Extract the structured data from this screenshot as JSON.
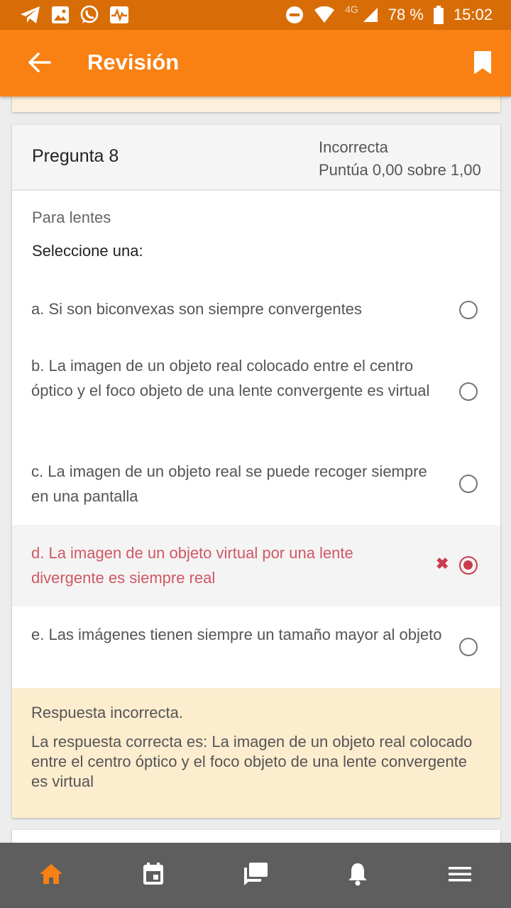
{
  "status_bar": {
    "battery": "78 %",
    "time": "15:02",
    "network": "4G"
  },
  "app_bar": {
    "title": "Revisión"
  },
  "question": {
    "title": "Pregunta 8",
    "state": "Incorrecta",
    "grade": "Puntúa 0,00 sobre 1,00",
    "text": "Para lentes",
    "prompt": "Seleccione una:",
    "options": [
      {
        "label": "a. Si son biconvexas son siempre convergentes",
        "selected": false
      },
      {
        "label": "b. La imagen de un objeto real colocado entre el centro óptico y el foco objeto de una lente convergente es virtual",
        "selected": false
      },
      {
        "label": "c. La imagen de un objeto real se puede recoger siempre en una pantalla",
        "selected": false
      },
      {
        "label": "d. La imagen de un objeto virtual por una lente divergente es siempre real",
        "selected": true,
        "incorrect": true
      },
      {
        "label": "e. Las imágenes tienen siempre un tamaño mayor al objeto",
        "selected": false
      }
    ],
    "feedback_title": "Respuesta incorrecta.",
    "feedback_answer": "La respuesta correcta es: La imagen de un objeto real colocado entre el centro óptico y el foco objeto de una lente convergente es virtual"
  },
  "bottom_nav": {
    "items": [
      "home-icon",
      "calendar-icon",
      "messages-icon",
      "notifications-icon",
      "menu-icon"
    ],
    "active": "home-icon"
  },
  "colors": {
    "accent": "#f98012",
    "status_bar": "#d86d07",
    "incorrect": "#ca3c4c",
    "feedback_bg": "#fdedcf",
    "nav_bg": "#5e5e5e"
  }
}
